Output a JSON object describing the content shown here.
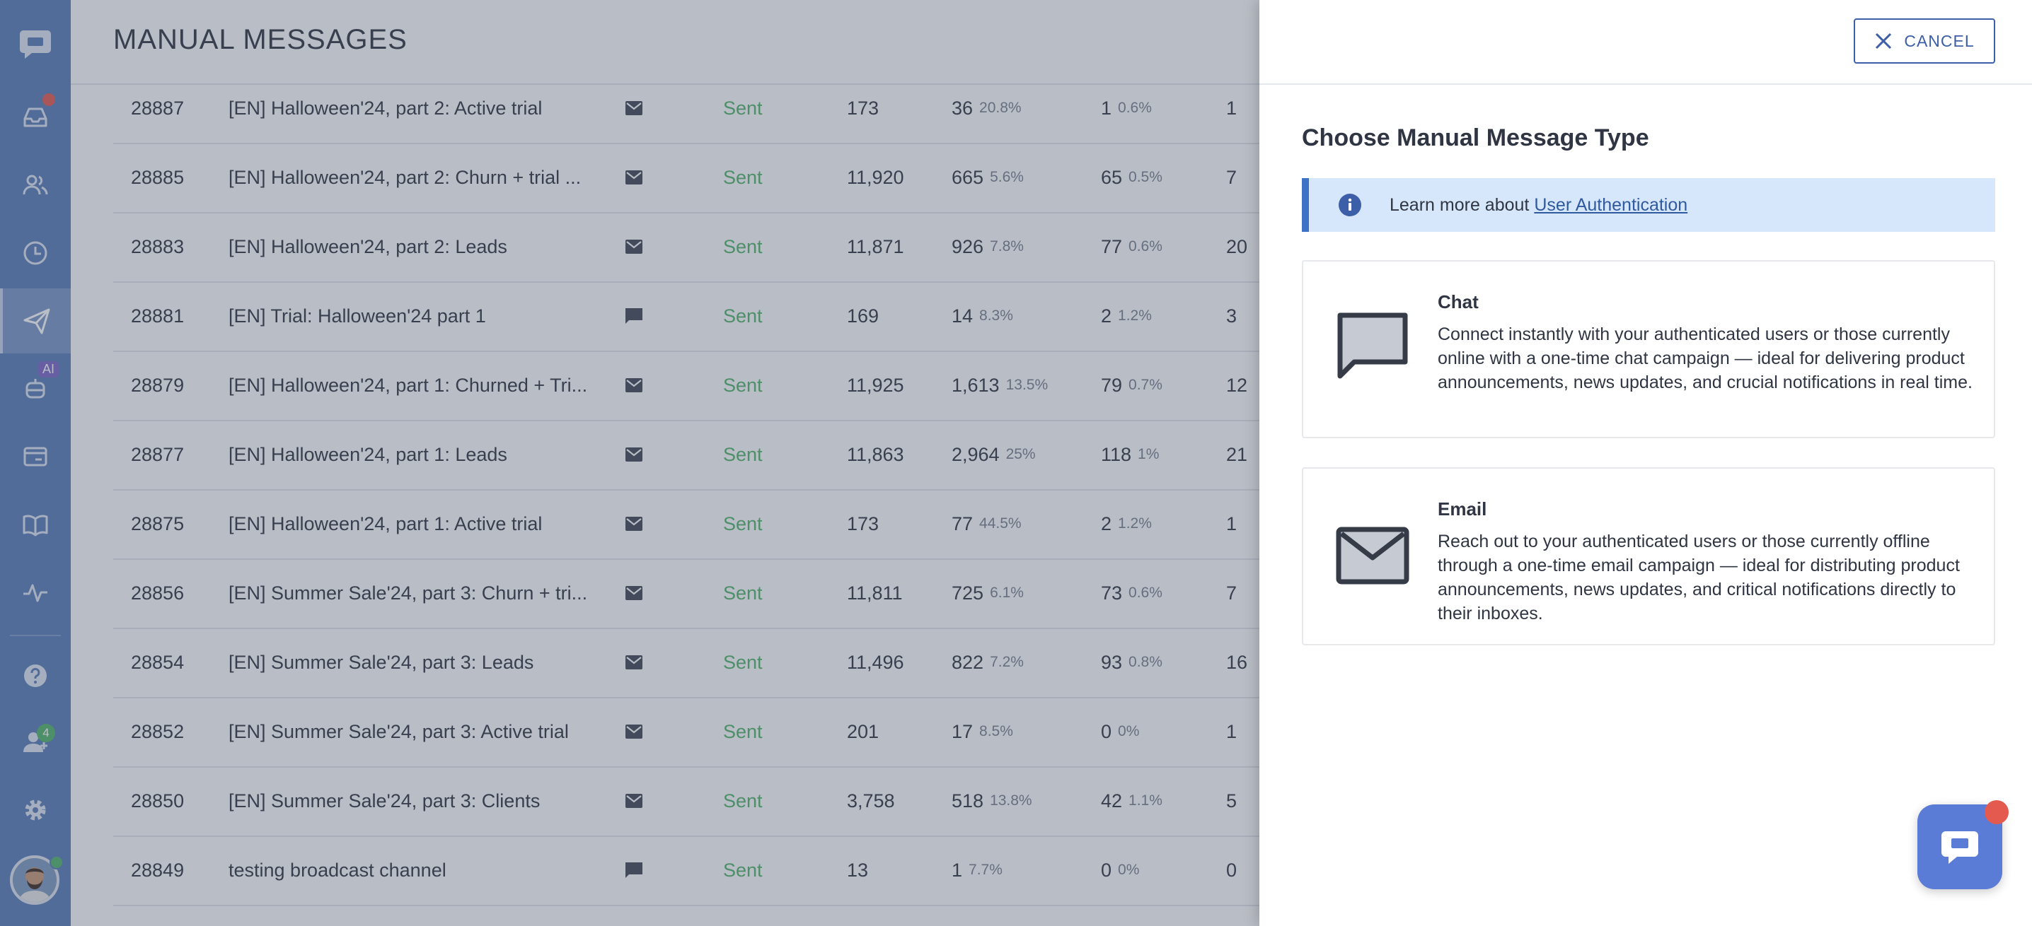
{
  "page": {
    "title": "MANUAL MESSAGES"
  },
  "sidebar": {
    "ai_badge": "AI",
    "team_count": "4",
    "items": [
      "chat-logo",
      "inbox",
      "contacts",
      "history",
      "messages",
      "ai-bot",
      "widget",
      "knowledge-base",
      "analytics",
      "help",
      "team",
      "settings"
    ]
  },
  "messages": [
    {
      "id": "28887",
      "name": "[EN] Halloween'24, part 2: Active trial",
      "type": "email",
      "status": "Sent",
      "sent": "173",
      "opened": "36",
      "opened_pct": "20.8%",
      "clicked": "1",
      "clicked_pct": "0.6%",
      "extra": "1"
    },
    {
      "id": "28885",
      "name": "[EN] Halloween'24, part 2: Churn + trial ...",
      "type": "email",
      "status": "Sent",
      "sent": "11,920",
      "opened": "665",
      "opened_pct": "5.6%",
      "clicked": "65",
      "clicked_pct": "0.5%",
      "extra": "7"
    },
    {
      "id": "28883",
      "name": "[EN] Halloween'24, part 2: Leads",
      "type": "email",
      "status": "Sent",
      "sent": "11,871",
      "opened": "926",
      "opened_pct": "7.8%",
      "clicked": "77",
      "clicked_pct": "0.6%",
      "extra": "20"
    },
    {
      "id": "28881",
      "name": "[EN] Trial: Halloween'24 part 1",
      "type": "chat",
      "status": "Sent",
      "sent": "169",
      "opened": "14",
      "opened_pct": "8.3%",
      "clicked": "2",
      "clicked_pct": "1.2%",
      "extra": "3"
    },
    {
      "id": "28879",
      "name": "[EN] Halloween'24, part 1: Churned + Tri...",
      "type": "email",
      "status": "Sent",
      "sent": "11,925",
      "opened": "1,613",
      "opened_pct": "13.5%",
      "clicked": "79",
      "clicked_pct": "0.7%",
      "extra": "12"
    },
    {
      "id": "28877",
      "name": "[EN] Halloween'24, part 1: Leads",
      "type": "email",
      "status": "Sent",
      "sent": "11,863",
      "opened": "2,964",
      "opened_pct": "25%",
      "clicked": "118",
      "clicked_pct": "1%",
      "extra": "21"
    },
    {
      "id": "28875",
      "name": "[EN] Halloween'24, part 1: Active trial",
      "type": "email",
      "status": "Sent",
      "sent": "173",
      "opened": "77",
      "opened_pct": "44.5%",
      "clicked": "2",
      "clicked_pct": "1.2%",
      "extra": "1"
    },
    {
      "id": "28856",
      "name": "[EN] Summer Sale'24, part 3: Churn + tri...",
      "type": "email",
      "status": "Sent",
      "sent": "11,811",
      "opened": "725",
      "opened_pct": "6.1%",
      "clicked": "73",
      "clicked_pct": "0.6%",
      "extra": "7"
    },
    {
      "id": "28854",
      "name": "[EN] Summer Sale'24, part 3: Leads",
      "type": "email",
      "status": "Sent",
      "sent": "11,496",
      "opened": "822",
      "opened_pct": "7.2%",
      "clicked": "93",
      "clicked_pct": "0.8%",
      "extra": "16"
    },
    {
      "id": "28852",
      "name": "[EN] Summer Sale'24, part 3: Active trial",
      "type": "email",
      "status": "Sent",
      "sent": "201",
      "opened": "17",
      "opened_pct": "8.5%",
      "clicked": "0",
      "clicked_pct": "0%",
      "extra": "1"
    },
    {
      "id": "28850",
      "name": "[EN] Summer Sale'24, part 3: Clients",
      "type": "email",
      "status": "Sent",
      "sent": "3,758",
      "opened": "518",
      "opened_pct": "13.8%",
      "clicked": "42",
      "clicked_pct": "1.1%",
      "extra": "5"
    },
    {
      "id": "28849",
      "name": "testing broadcast channel",
      "type": "chat",
      "status": "Sent",
      "sent": "13",
      "opened": "1",
      "opened_pct": "7.7%",
      "clicked": "0",
      "clicked_pct": "0%",
      "extra": "0"
    }
  ],
  "panel": {
    "cancel_label": "CANCEL",
    "title": "Choose Manual Message Type",
    "info_text": "Learn more about",
    "info_link": "User Authentication",
    "options": [
      {
        "title": "Chat",
        "icon": "chat-bubble-icon",
        "description": "Connect instantly with your authenticated users or those currently online with a one-time chat campaign — ideal for delivering product announcements, news updates, and crucial notifications in real time."
      },
      {
        "title": "Email",
        "icon": "envelope-icon",
        "description": "Reach out to your authenticated users or those currently offline through a one-time email campaign — ideal for distributing product announcements, news updates, and critical notifications directly to their inboxes."
      }
    ]
  },
  "colors": {
    "sidebar": "#5a7cb8",
    "accent": "#3d5fa8",
    "status_sent": "#52b56a",
    "info_bg": "#d7e7fb",
    "notification": "#e45a4e"
  }
}
